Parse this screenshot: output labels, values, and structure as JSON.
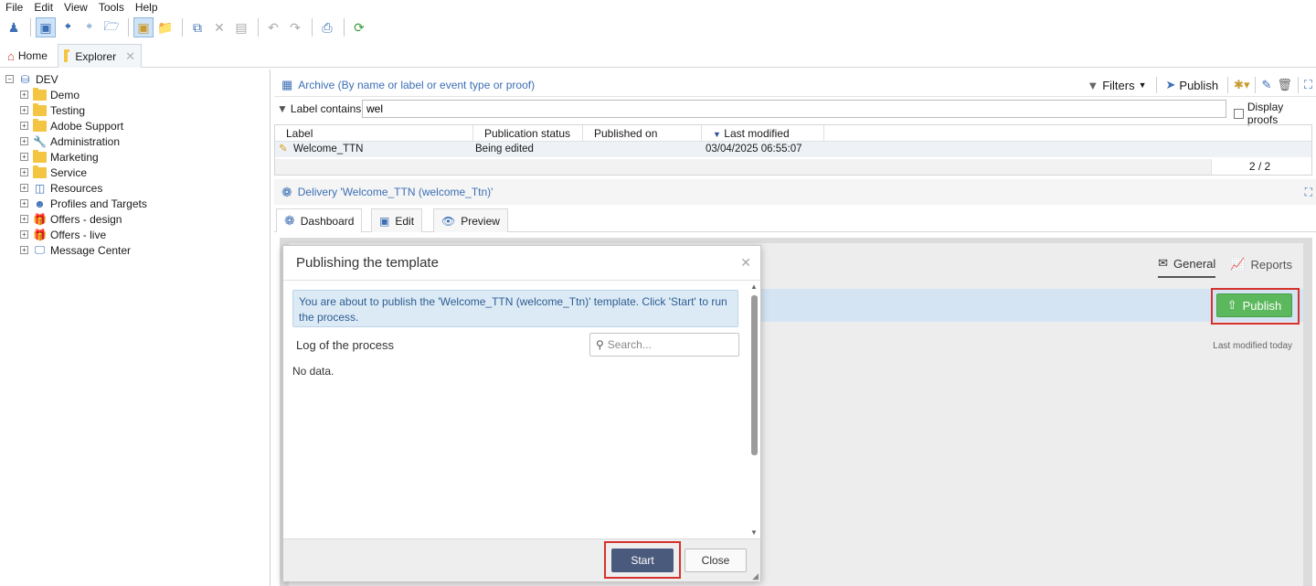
{
  "menu": [
    "File",
    "Edit",
    "View",
    "Tools",
    "Help"
  ],
  "tabs": {
    "home": "Home",
    "explorer": "Explorer"
  },
  "tree": {
    "root": "DEV",
    "items": [
      "Demo",
      "Testing",
      "Adobe Support",
      "Administration",
      "Marketing",
      "Service",
      "Resources",
      "Profiles and Targets",
      "Offers - design",
      "Offers - live",
      "Message Center"
    ]
  },
  "archive": {
    "title": "Archive (By name or label or event type or proof)",
    "filters_label": "Filters",
    "publish_label": "Publish"
  },
  "filter": {
    "label": "Label contains:",
    "value": "wel",
    "display_proofs": "Display proofs"
  },
  "grid": {
    "columns": [
      "Label",
      "Publication status",
      "Published on",
      "Last modified"
    ],
    "rows": [
      {
        "label": "Welcome_TTN",
        "status": "Being edited",
        "published_on": "",
        "last_modified": "03/04/2025 06:55:07"
      }
    ],
    "count": "2 / 2"
  },
  "delivery": {
    "title": "Delivery 'Welcome_TTN (welcome_Ttn)'",
    "tabs": [
      "Dashboard",
      "Edit",
      "Preview"
    ],
    "view_tabs": [
      "General",
      "Reports"
    ],
    "publish_label": "Publish",
    "last_modified": "Last modified today"
  },
  "modal": {
    "title": "Publishing the template",
    "info": "You are about to publish the 'Welcome_TTN (welcome_Ttn)' template. Click 'Start' to run the process.",
    "log_title": "Log of the process",
    "search_placeholder": "Search...",
    "no_data": "No data.",
    "start": "Start",
    "close": "Close"
  }
}
